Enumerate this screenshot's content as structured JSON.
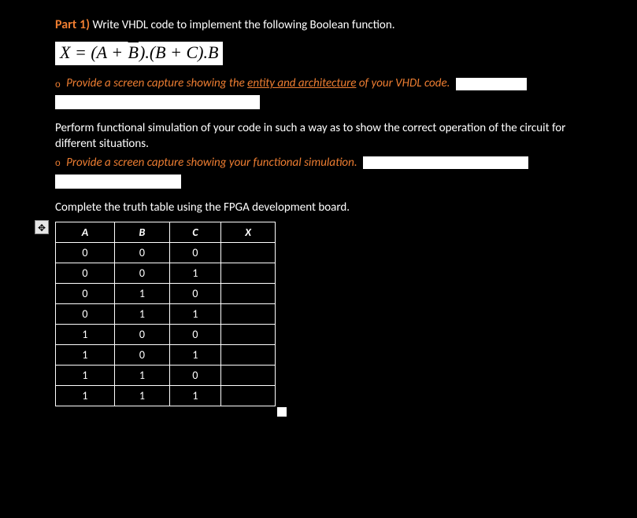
{
  "part": {
    "label": "Part 1)",
    "text": "Write VHDL code to implement the following Boolean function."
  },
  "equation": {
    "lhs": "X",
    "eq": " = ",
    "open1": "(",
    "A": "A",
    "plus1": " + ",
    "Bbar": "B",
    "close1": ").",
    "open2": "(",
    "B": "B",
    "plus2": " + ",
    "C": "C",
    "close2": ").",
    "Bend": "B"
  },
  "instr1": {
    "bullet": "o",
    "pre": "Provide a screen capture showing the ",
    "u": "entity and architecture",
    "post": " of your VHDL code."
  },
  "body1": "Perform functional simulation of your code in such a way as to show the correct operation of the circuit for different situations.",
  "instr2": {
    "bullet": "o",
    "text": "Provide a screen capture showing your functional simulation."
  },
  "body2": "Complete the truth table using the FPGA development board.",
  "moveHandle": "✥",
  "table": {
    "headers": [
      "A",
      "B",
      "C",
      "X"
    ],
    "rows": [
      [
        "0",
        "0",
        "0",
        ""
      ],
      [
        "0",
        "0",
        "1",
        ""
      ],
      [
        "0",
        "1",
        "0",
        ""
      ],
      [
        "0",
        "1",
        "1",
        ""
      ],
      [
        "1",
        "0",
        "0",
        ""
      ],
      [
        "1",
        "0",
        "1",
        ""
      ],
      [
        "1",
        "1",
        "0",
        ""
      ],
      [
        "1",
        "1",
        "1",
        ""
      ]
    ]
  }
}
